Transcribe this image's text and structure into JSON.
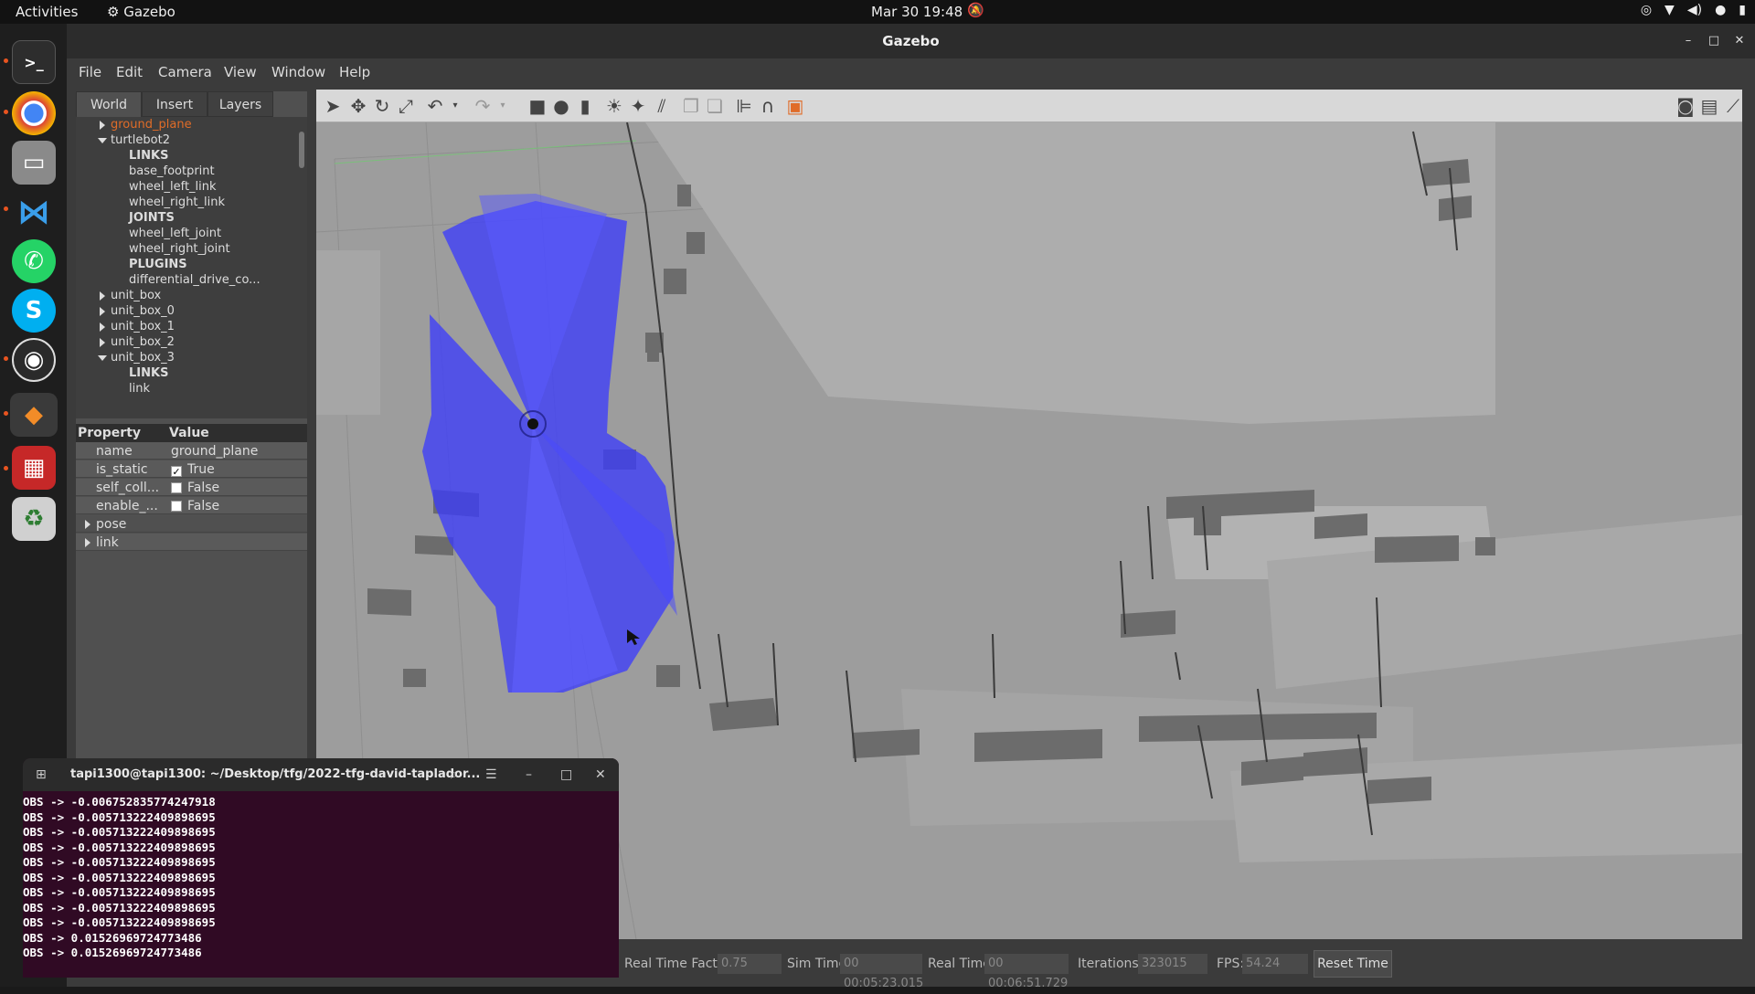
{
  "topbar": {
    "activities": "Activities",
    "app_name": "Gazebo",
    "datetime": "Mar 30  19:48"
  },
  "window": {
    "title": "Gazebo"
  },
  "menu": [
    "File",
    "Edit",
    "Camera",
    "View",
    "Window",
    "Help"
  ],
  "tabs": [
    "World",
    "Insert",
    "Layers"
  ],
  "tree": [
    {
      "label": "ground_plane",
      "indent": 1,
      "caret": "right",
      "highlight": true
    },
    {
      "label": "turtlebot2",
      "indent": 1,
      "caret": "down"
    },
    {
      "label": "LINKS",
      "indent": 2,
      "bold": true
    },
    {
      "label": "base_footprint",
      "indent": 2
    },
    {
      "label": "wheel_left_link",
      "indent": 2
    },
    {
      "label": "wheel_right_link",
      "indent": 2
    },
    {
      "label": "JOINTS",
      "indent": 2,
      "bold": true
    },
    {
      "label": "wheel_left_joint",
      "indent": 2
    },
    {
      "label": "wheel_right_joint",
      "indent": 2
    },
    {
      "label": "PLUGINS",
      "indent": 2,
      "bold": true
    },
    {
      "label": "differential_drive_co...",
      "indent": 2
    },
    {
      "label": "unit_box",
      "indent": 1,
      "caret": "right"
    },
    {
      "label": "unit_box_0",
      "indent": 1,
      "caret": "right"
    },
    {
      "label": "unit_box_1",
      "indent": 1,
      "caret": "right"
    },
    {
      "label": "unit_box_2",
      "indent": 1,
      "caret": "right"
    },
    {
      "label": "unit_box_3",
      "indent": 1,
      "caret": "down"
    },
    {
      "label": "LINKS",
      "indent": 2,
      "bold": true
    },
    {
      "label": "link",
      "indent": 2
    }
  ],
  "properties": {
    "header_property": "Property",
    "header_value": "Value",
    "rows": [
      {
        "name": "name",
        "value": "ground_plane",
        "check": null
      },
      {
        "name": "is_static",
        "value": "True",
        "check": true
      },
      {
        "name": "self_coll...",
        "value": "False",
        "check": false
      },
      {
        "name": "enable_...",
        "value": "False",
        "check": false
      }
    ],
    "groups": [
      "pose",
      "link"
    ]
  },
  "status": {
    "rtf_label": "Real Time Factor:",
    "rtf_value": "0.75",
    "sim_label": "Sim Time:",
    "sim_value": "00 00:05:23.015",
    "real_label": "Real Time:",
    "real_value": "00 00:06:51.729",
    "iter_label": "Iterations:",
    "iter_value": "323015",
    "fps_label": "FPS:",
    "fps_value": "54.24",
    "reset_label": "Reset Time"
  },
  "terminal": {
    "title": "tapi1300@tapi1300: ~/Desktop/tfg/2022-tfg-david-taplador...",
    "lines": [
      "OBS -> -0.006752835774247918",
      "OBS -> -0.005713222409898695",
      "OBS -> -0.005713222409898695",
      "OBS -> -0.005713222409898695",
      "OBS -> -0.005713222409898695",
      "OBS -> -0.005713222409898695",
      "OBS -> -0.005713222409898695",
      "OBS -> -0.005713222409898695",
      "OBS -> -0.005713222409898695",
      "OBS -> 0.01526969724773486",
      "OBS -> 0.01526969724773486"
    ],
    "bg_color": "#300a24"
  },
  "colors": {
    "laser": "#3a3aff",
    "floor": "#9d9d9d",
    "accent": "#e06c28"
  }
}
